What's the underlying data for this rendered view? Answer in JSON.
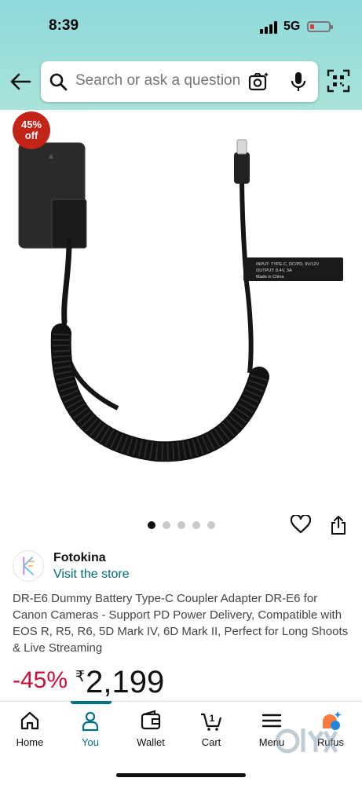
{
  "status_bar": {
    "time": "8:39",
    "network": "5G"
  },
  "search": {
    "placeholder": "Search or ask a question"
  },
  "product": {
    "discount_badge_pct": "45%",
    "discount_badge_off": "off",
    "image_count": 5,
    "active_image": 1,
    "brand_name": "Fotokina",
    "brand_link": "Visit the store",
    "title": "DR-E6 Dummy Battery Type-C Coupler Adapter DR-E6 for Canon Cameras - Support PD Power Delivery, Compatible with EOS R, R5, R6, 5D Mark IV, 6D Mark II, Perfect for Long Shoots & Live Streaming",
    "discount": "-45%",
    "currency": "₹",
    "price": "2,199",
    "tag_lines": [
      "INPUT: TYPE-C, DC/PD, 9V/12V",
      "OUTPUT: 8.4V, 3A",
      "Made in China"
    ]
  },
  "nav": {
    "items": [
      {
        "label": "Home",
        "icon": "home-icon"
      },
      {
        "label": "You",
        "icon": "user-icon"
      },
      {
        "label": "Wallet",
        "icon": "wallet-icon"
      },
      {
        "label": "Cart",
        "icon": "cart-icon",
        "count": "1"
      },
      {
        "label": "Menu",
        "icon": "menu-icon"
      },
      {
        "label": "Rufus",
        "icon": "rufus-icon"
      }
    ],
    "active": "You"
  },
  "colors": {
    "header": "#8fd9dc",
    "badge": "#c42318",
    "discount": "#cc0c39",
    "link": "#007185"
  }
}
